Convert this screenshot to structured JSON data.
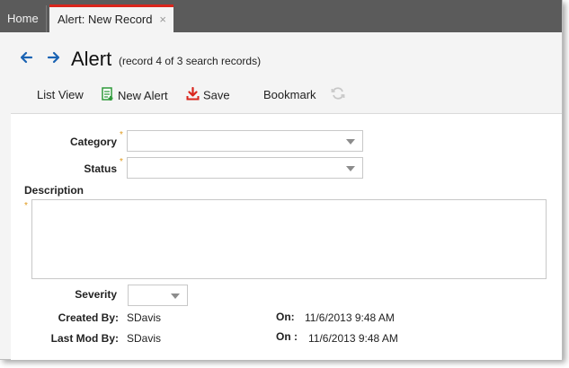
{
  "tabs": {
    "home_label": "Home",
    "active_label": "Alert: New Record",
    "close_glyph": "×"
  },
  "header": {
    "title": "Alert",
    "record_info": "(record 4 of 3 search records)",
    "back_icon": "arrow-left-icon",
    "forward_icon": "arrow-right-icon"
  },
  "toolbar": {
    "list_view": "List View",
    "new_alert": "New Alert",
    "save": "Save",
    "bookmark": "Bookmark",
    "refresh_icon": "refresh-icon"
  },
  "form": {
    "category_label": "Category",
    "category_value": "",
    "status_label": "Status",
    "status_value": "",
    "description_label": "Description",
    "description_value": "",
    "severity_label": "Severity",
    "severity_value": "",
    "required_marker": "*",
    "created_by_label": "Created By:",
    "created_by_value": "SDavis",
    "created_on_label": "On:",
    "created_on_value": "11/6/2013 9:48 AM",
    "last_mod_by_label": "Last Mod By:",
    "last_mod_by_value": "SDavis",
    "last_mod_on_label": "On :",
    "last_mod_on_value": "11/6/2013 9:48 AM"
  },
  "colors": {
    "tabbar": "#5b5b5b",
    "active_tab_accent": "#d9251c",
    "nav_arrow": "#1a63b3",
    "new_alert_icon": "#2e9a3a",
    "save_icon": "#d9251c",
    "required_marker": "#e09a1c"
  }
}
